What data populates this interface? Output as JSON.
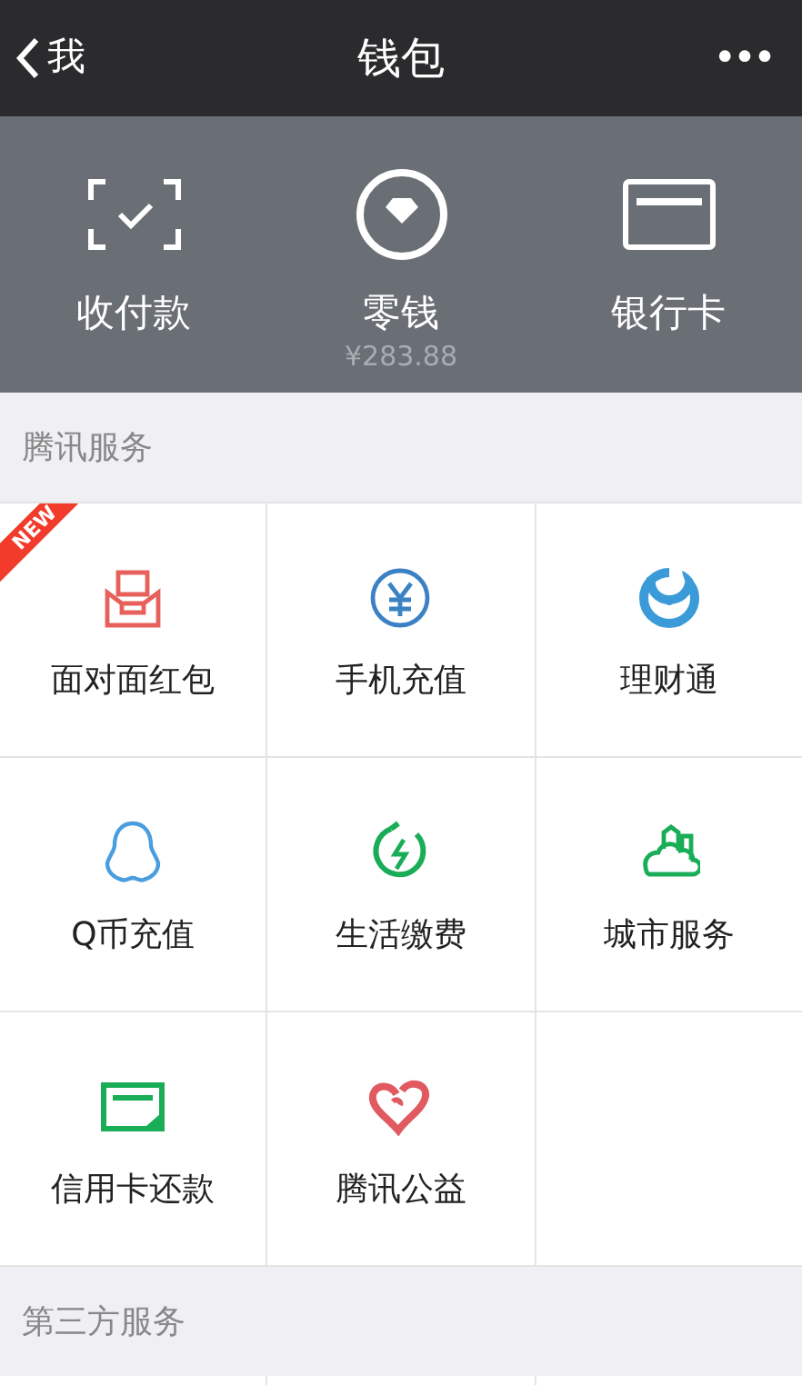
{
  "nav_bar": {
    "back_label": "我",
    "title": "钱包",
    "more": "•••"
  },
  "wallet_actions": [
    {
      "label": "收付款"
    },
    {
      "label": "零钱",
      "amount": "¥283.88"
    },
    {
      "label": "银行卡"
    }
  ],
  "sections": [
    {
      "title": "腾讯服务",
      "items": [
        {
          "label": "面对面红包",
          "badge": "NEW"
        },
        {
          "label": "手机充值"
        },
        {
          "label": "理财通"
        },
        {
          "label": "Q币充值"
        },
        {
          "label": "生活缴费"
        },
        {
          "label": "城市服务"
        },
        {
          "label": "信用卡还款"
        },
        {
          "label": "腾讯公益"
        }
      ]
    },
    {
      "title": "第三方服务"
    }
  ]
}
